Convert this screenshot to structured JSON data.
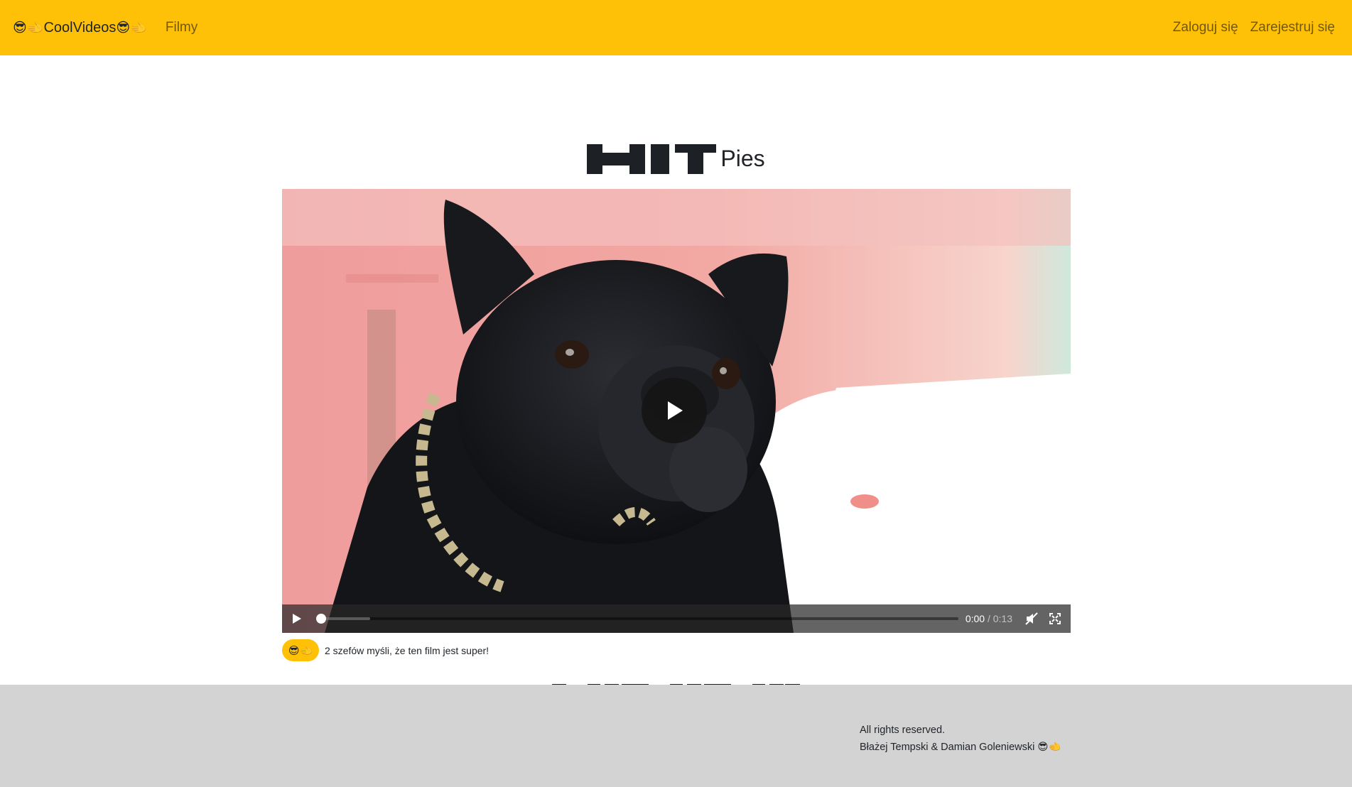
{
  "header": {
    "brand": {
      "prefix_emoji": "😎🫲",
      "name": "CoolVideos",
      "suffix_emoji": "😎🫲"
    },
    "nav_link": "Filmy",
    "login": "Zaloguj się",
    "register": "Zarejestruj się",
    "bg_color": "#ffc107"
  },
  "video_page": {
    "logo_text": "HIT",
    "title": "Pies",
    "player": {
      "current_time": "0:00",
      "separator": " / ",
      "duration": "0:13",
      "buffered_fraction": 0.08,
      "muted": true
    },
    "likes": {
      "badge": "😎🫲",
      "text": "2 szefów myśli, że ten film jest super!"
    },
    "bottom_logo_text": "HITHITHIT"
  },
  "footer": {
    "line1": "All rights reserved.",
    "line2": "Błażej Tempski & Damian Goleniewski 😎🫲"
  }
}
